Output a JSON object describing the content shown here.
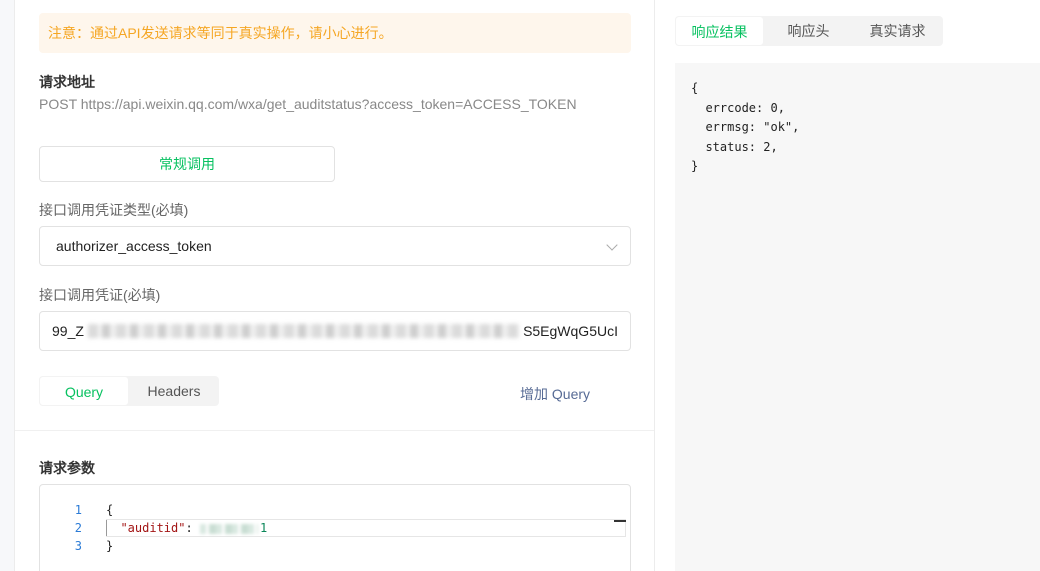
{
  "notice": "注意：通过API发送请求等同于真实操作，请小心进行。",
  "request_url": {
    "label": "请求地址",
    "value": "POST https://api.weixin.qq.com/wxa/get_auditstatus?access_token=ACCESS_TOKEN"
  },
  "mode_button": "常规调用",
  "credential_type": {
    "label": "接口调用凭证类型(必填)",
    "selected": "authorizer_access_token"
  },
  "credential": {
    "label": "接口调用凭证(必填)",
    "prefix": "99_Z",
    "suffix": "S5EgWqG5UcI"
  },
  "param_tabs": [
    "Query",
    "Headers"
  ],
  "add_query": "增加 Query",
  "params": {
    "label": "请求参数",
    "lines": [
      {
        "num": "1",
        "text": "{"
      },
      {
        "num": "2",
        "key": "\"auditid\"",
        "sep": ": ",
        "tail": "1"
      },
      {
        "num": "3",
        "text": "}"
      }
    ]
  },
  "response_tabs": [
    "响应结果",
    "响应头",
    "真实请求"
  ],
  "response_body": "{\n  errcode: 0,\n  errmsg: \"ok\",\n  status: 2,\n}"
}
